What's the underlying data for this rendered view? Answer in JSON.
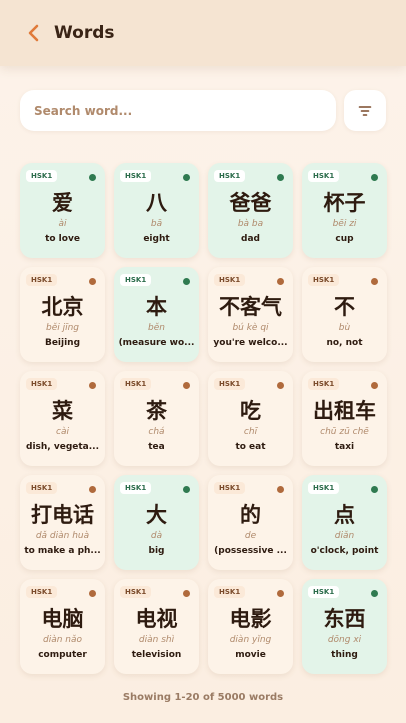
{
  "header": {
    "title": "Words"
  },
  "search": {
    "placeholder": "Search word..."
  },
  "colors": {
    "accent": "#e07a3a",
    "known": "#2f7a50",
    "learning": "#b06a3c"
  },
  "words": [
    {
      "level": "HSK1",
      "hanzi": "爱",
      "pinyin": "ài",
      "meaning": "to love",
      "status": "green"
    },
    {
      "level": "HSK1",
      "hanzi": "八",
      "pinyin": "bā",
      "meaning": "eight",
      "status": "green"
    },
    {
      "level": "HSK1",
      "hanzi": "爸爸",
      "pinyin": "bà ba",
      "meaning": "dad",
      "status": "green"
    },
    {
      "level": "HSK1",
      "hanzi": "杯子",
      "pinyin": "bēi zi",
      "meaning": "cup",
      "status": "green"
    },
    {
      "level": "HSK1",
      "hanzi": "北京",
      "pinyin": "běi jīng",
      "meaning": "Beijing",
      "status": "orange"
    },
    {
      "level": "HSK1",
      "hanzi": "本",
      "pinyin": "běn",
      "meaning": "(measure wo...",
      "status": "green"
    },
    {
      "level": "HSK1",
      "hanzi": "不客气",
      "pinyin": "bú kè qi",
      "meaning": "you're welco...",
      "status": "orange"
    },
    {
      "level": "HSK1",
      "hanzi": "不",
      "pinyin": "bù",
      "meaning": "no, not",
      "status": "orange"
    },
    {
      "level": "HSK1",
      "hanzi": "菜",
      "pinyin": "cài",
      "meaning": "dish, vegeta...",
      "status": "orange"
    },
    {
      "level": "HSK1",
      "hanzi": "茶",
      "pinyin": "chá",
      "meaning": "tea",
      "status": "orange"
    },
    {
      "level": "HSK1",
      "hanzi": "吃",
      "pinyin": "chī",
      "meaning": "to eat",
      "status": "orange"
    },
    {
      "level": "HSK1",
      "hanzi": "出租车",
      "pinyin": "chū zū chē",
      "meaning": "taxi",
      "status": "orange"
    },
    {
      "level": "HSK1",
      "hanzi": "打电话",
      "pinyin": "dǎ diàn huà",
      "meaning": "to make a ph...",
      "status": "orange"
    },
    {
      "level": "HSK1",
      "hanzi": "大",
      "pinyin": "dà",
      "meaning": "big",
      "status": "green"
    },
    {
      "level": "HSK1",
      "hanzi": "的",
      "pinyin": "de",
      "meaning": "(possessive ...",
      "status": "orange"
    },
    {
      "level": "HSK1",
      "hanzi": "点",
      "pinyin": "diǎn",
      "meaning": "o'clock, point",
      "status": "green"
    },
    {
      "level": "HSK1",
      "hanzi": "电脑",
      "pinyin": "diàn nǎo",
      "meaning": "computer",
      "status": "orange"
    },
    {
      "level": "HSK1",
      "hanzi": "电视",
      "pinyin": "diàn shì",
      "meaning": "television",
      "status": "orange"
    },
    {
      "level": "HSK1",
      "hanzi": "电影",
      "pinyin": "diàn yǐng",
      "meaning": "movie",
      "status": "orange"
    },
    {
      "level": "HSK1",
      "hanzi": "东西",
      "pinyin": "dōng xi",
      "meaning": "thing",
      "status": "green"
    }
  ],
  "footer": {
    "text": "Showing 1-20 of 5000 words"
  }
}
